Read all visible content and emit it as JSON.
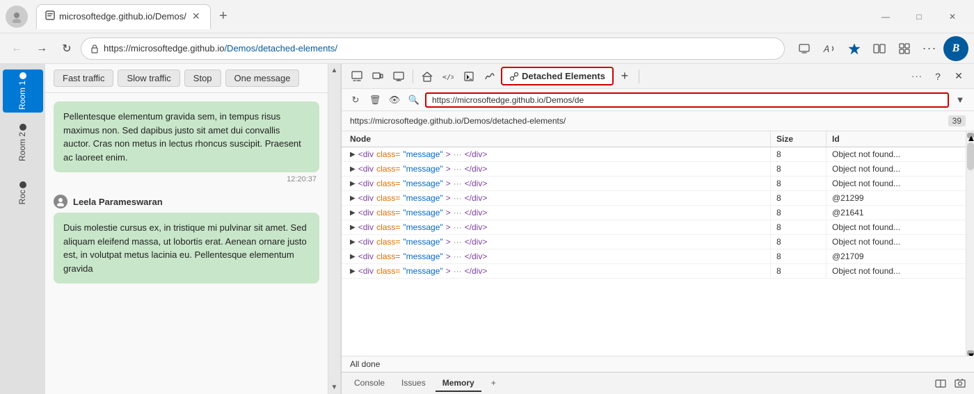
{
  "window": {
    "title": "microsoftedge.github.io/Demos/",
    "url_display": "https://microsoftedge.github.io/Demos/detached-elements/",
    "url_short": "https://microsoftedge.github.io/Demos/de",
    "tab_label": "microsoftedge.github.io/Demos/",
    "minimize": "—",
    "maximize": "□",
    "close": "✕"
  },
  "nav_buttons": {
    "back": "←",
    "forward": "→",
    "refresh": "↻"
  },
  "toolbar_icons": {
    "bookmark": "☆",
    "profile": "⊕",
    "extensions": "⊞",
    "more": "···",
    "help": "?",
    "close_devtools": "✕"
  },
  "chat": {
    "rooms": [
      {
        "id": "room1",
        "label": "Room 1",
        "active": true
      },
      {
        "id": "room2",
        "label": "Room 2",
        "active": false
      },
      {
        "id": "room3",
        "label": "Roc",
        "active": false
      }
    ],
    "buttons": [
      {
        "id": "fast-traffic",
        "label": "Fast traffic"
      },
      {
        "id": "slow-traffic",
        "label": "Slow traffic"
      },
      {
        "id": "stop",
        "label": "Stop"
      },
      {
        "id": "one-message",
        "label": "One message"
      }
    ],
    "messages": [
      {
        "id": "msg1",
        "sender": null,
        "text": "Pellentesque elementum gravida sem, in tempus risus maximus non. Sed dapibus justo sit amet dui convallis auctor. Cras non metus in lectus rhoncus suscipit. Praesent ac laoreet enim.",
        "time": "12:20:37"
      },
      {
        "id": "msg2",
        "sender": "Leela Parameswaran",
        "text": "Duis molestie cursus ex, in tristique mi pulvinar sit amet. Sed aliquam eleifend massa, ut lobortis erat. Aenean ornare justo est, in volutpat metus lacinia eu. Pellentesque elementum gravida",
        "time": null
      }
    ]
  },
  "devtools": {
    "toolbar_buttons": [
      {
        "id": "inspect",
        "icon": "⬚",
        "label": ""
      },
      {
        "id": "device",
        "icon": "⬚",
        "label": ""
      },
      {
        "id": "emulate",
        "icon": "◫",
        "label": ""
      },
      {
        "id": "elements",
        "icon": "</>"
      },
      {
        "id": "console-btn",
        "icon": "⌨"
      },
      {
        "id": "detached",
        "label": "Detached Elements",
        "active": true
      }
    ],
    "url_bar_value": "https://microsoftedge.github.io/Demos/de",
    "page_url": "https://microsoftedge.github.io/Demos/detached-elements/",
    "badge": "39",
    "columns": [
      {
        "id": "node",
        "label": "Node"
      },
      {
        "id": "size",
        "label": "Size"
      },
      {
        "id": "id",
        "label": "Id"
      }
    ],
    "rows": [
      {
        "node": "<div class=\"message\"> ··· </div>",
        "size": "8",
        "id": "Object not found..."
      },
      {
        "node": "<div class=\"message\"> ··· </div>",
        "size": "8",
        "id": "Object not found..."
      },
      {
        "node": "<div class=\"message\"> ··· </div>",
        "size": "8",
        "id": "Object not found..."
      },
      {
        "node": "<div class=\"message\"> ··· </div>",
        "size": "8",
        "id": "@21299"
      },
      {
        "node": "<div class=\"message\"> ··· </div>",
        "size": "8",
        "id": "@21641"
      },
      {
        "node": "<div class=\"message\"> ··· </div>",
        "size": "8",
        "id": "Object not found..."
      },
      {
        "node": "<div class=\"message\"> ··· </div>",
        "size": "8",
        "id": "Object not found..."
      },
      {
        "node": "<div class=\"message\"> ··· </div>",
        "size": "8",
        "id": "@21709"
      },
      {
        "node": "<div class=\"message\"> ··· </div>",
        "size": "8",
        "id": "Object not found..."
      }
    ],
    "status": "All done",
    "bottom_tabs": [
      {
        "id": "console",
        "label": "Console",
        "active": false
      },
      {
        "id": "issues",
        "label": "Issues",
        "active": false
      },
      {
        "id": "memory",
        "label": "Memory",
        "active": true
      }
    ],
    "add_tab_icon": "+",
    "bottom_icons": {
      "dock": "⬚",
      "screenshot": "📷"
    }
  }
}
